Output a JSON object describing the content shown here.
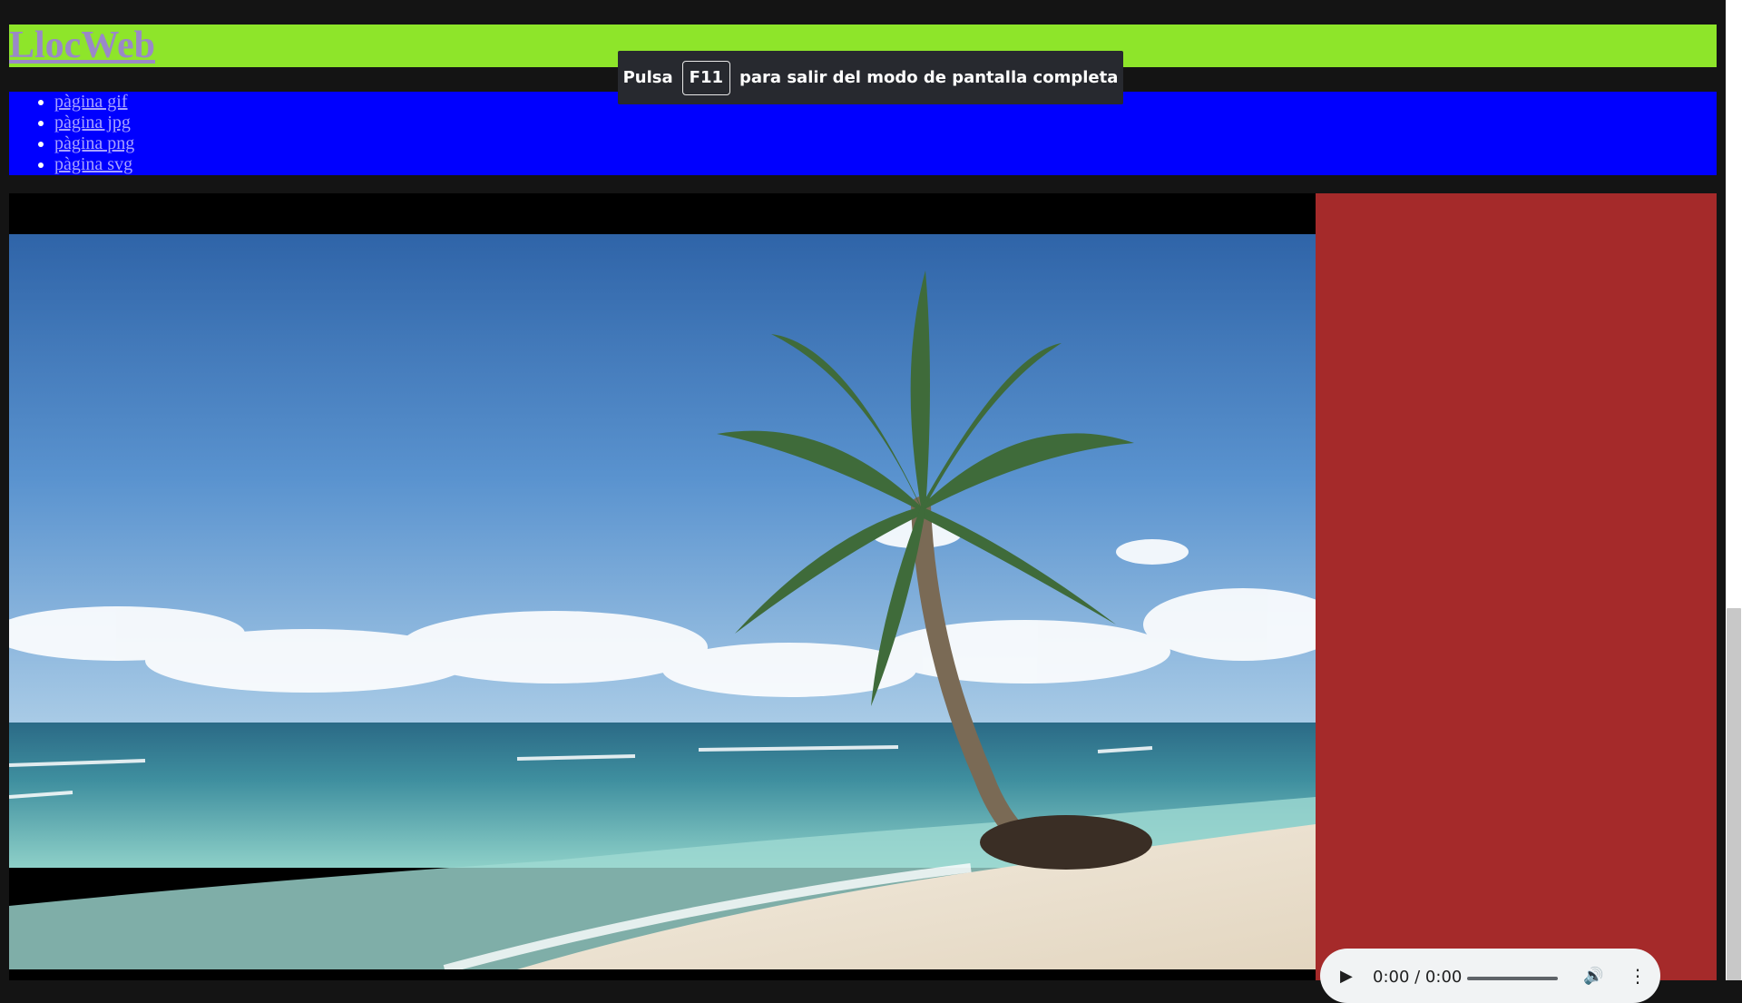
{
  "site": {
    "title": "LlocWeb"
  },
  "nav": {
    "links": [
      {
        "label": "pàgina gif"
      },
      {
        "label": "pàgina jpg"
      },
      {
        "label": "pàgina png"
      },
      {
        "label": "pàgina svg"
      }
    ]
  },
  "fullscreen_notice": {
    "before": "Pulsa",
    "key": "F11",
    "after": "para salir del modo de pantalla completa"
  },
  "audio_player": {
    "time": "0:00 / 0:00",
    "play_icon": "play-icon",
    "volume_icon": "volume-icon",
    "more_icon": "more-options-icon"
  },
  "colors": {
    "header_bg": "#8ee52a",
    "nav_bg": "#0000ff",
    "aside_bg": "#a52a2a",
    "video_bg": "#000000"
  }
}
